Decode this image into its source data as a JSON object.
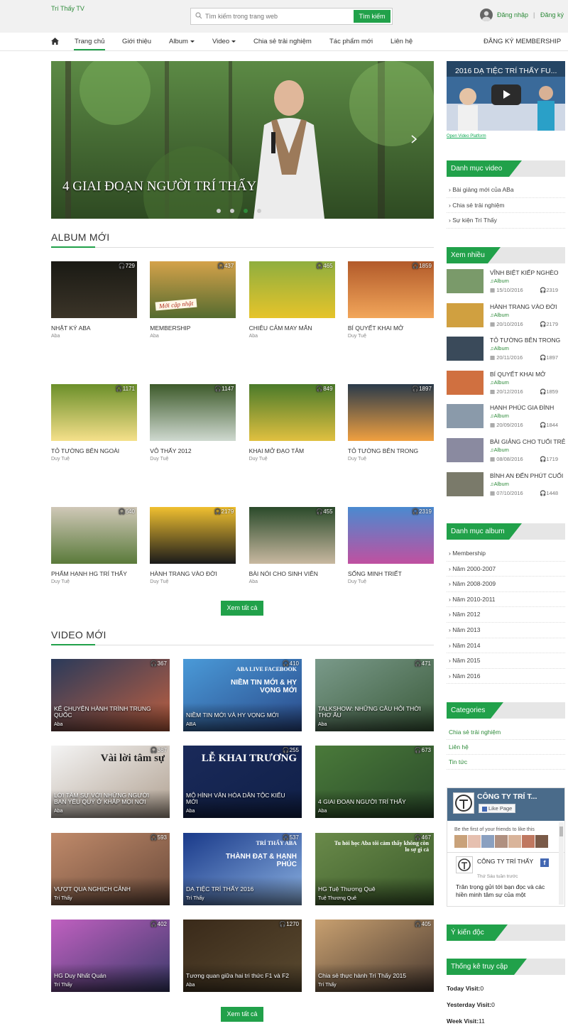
{
  "header": {
    "logo": "Trí Thấy TV",
    "search_placeholder": "Tìm kiếm trong trang web",
    "search_button": "Tìm kiếm",
    "login": "Đăng nhập",
    "separator": "|",
    "register": "Đăng ký"
  },
  "nav": {
    "items": [
      "Trang chủ",
      "Giới thiệu",
      "Album",
      "Video",
      "Chia sẻ trải nghiệm",
      "Tác phẩm mới",
      "Liên hệ"
    ],
    "membership": "ĐĂNG KÝ MEMBERSHIP"
  },
  "slider": {
    "caption": "4 GIAI ĐOẠN NGƯỜI TRÍ THẤY",
    "slide_count": 4,
    "active_slide": 3
  },
  "album_section": {
    "title": "ALBUM MỚI",
    "view_all": "Xem tất cả",
    "items": [
      {
        "title": "NHẬT KÝ ABA",
        "author": "Aba",
        "views": "729"
      },
      {
        "title": "MEMBERSHIP",
        "author": "Aba",
        "views": "437",
        "overlay": "Mới cập nhật"
      },
      {
        "title": "CHIÊU CẢM MAY MẮN",
        "author": "Aba",
        "views": "465"
      },
      {
        "title": "BÍ QUYẾT KHAI MỞ",
        "author": "Duy Tuệ",
        "views": "1859"
      },
      {
        "title": "TỎ TƯỜNG BÊN NGOÀI",
        "author": "Duy Tuệ",
        "views": "1171"
      },
      {
        "title": "VÔ THẤY 2012",
        "author": "Duy Tuệ",
        "views": "1147"
      },
      {
        "title": "KHAI MỞ ĐẠO TÂM",
        "author": "Duy Tuệ",
        "views": "849"
      },
      {
        "title": "TỎ TƯỜNG BÊN TRONG",
        "author": "Duy Tuệ",
        "views": "1897"
      },
      {
        "title": "PHẨM HẠNH HG TRÍ THẤY",
        "author": "Duy Tuệ",
        "views": "640"
      },
      {
        "title": "HÀNH TRANG VÀO ĐỜI",
        "author": "Duy Tuệ",
        "views": "2179"
      },
      {
        "title": "BÀI NÓI CHO SINH VIÊN",
        "author": "Aba",
        "views": "455"
      },
      {
        "title": "SỐNG MINH TRIẾT",
        "author": "Duy Tuệ",
        "views": "2319"
      }
    ]
  },
  "video_section": {
    "title": "VIDEO MỚI",
    "view_all": "Xem tất cả",
    "items": [
      {
        "title": "KỂ CHUYỆN HÀNH TRÌNH TRUNG QUỐC",
        "author": "Aba",
        "views": "367"
      },
      {
        "title": "NIỀM TIN MỚI VÀ HY VỌNG MỚI",
        "author": "ABA",
        "views": "410",
        "overlay_1": "ABA LIVE FACEBOOK",
        "overlay_2": "NIỀM TIN MỚI & HY VỌNG MỚI"
      },
      {
        "title": "TALKSHOW: NHỮNG CÂU HỎI THỜI THƠ ẤU",
        "author": "Aba",
        "views": "471"
      },
      {
        "title": "LỜI TÂM SỰ VỚI NHỮNG NGƯỜI BẠN YÊU QUÝ Ở KHẮP MỌI NƠI",
        "author": "Aba",
        "views": "367",
        "overlay_1": "Vài lời tâm sự"
      },
      {
        "title": "MÔ HÌNH VĂN HÓA DÂN TỘC KIỂU MỚI",
        "author": "Aba",
        "views": "255",
        "overlay_1": "LỄ KHAI TRƯƠNG"
      },
      {
        "title": "4 GIAI ĐOẠN NGƯỜI TRÍ THẤY",
        "author": "Aba",
        "views": "673"
      },
      {
        "title": "VƯỢT QUA NGHỊCH CẢNH",
        "author": "Trí Thấy",
        "views": "593"
      },
      {
        "title": "DẠ TIỆC TRÍ THẤY 2016",
        "author": "Trí Thấy",
        "views": "537",
        "overlay_1": "TRÍ THẤY ABA",
        "overlay_2": "THÀNH ĐẠT & HẠNH PHÚC"
      },
      {
        "title": "HG Tuệ Thương Quê",
        "author": "Tuệ Thương Quê",
        "views": "467",
        "overlay_1": "Tu hỏi học Aba tôi cảm thấy không còn lo sợ gì cả"
      },
      {
        "title": "HG Duy Nhất Quán",
        "author": "Trí Thấy",
        "views": "402"
      },
      {
        "title": "Tương quan giữa hai tri thức F1 và F2",
        "author": "Aba",
        "views": "1270"
      },
      {
        "title": "Chia sẻ thực hành Trí Thấy 2015",
        "author": "Trí Thấy",
        "views": "405"
      }
    ]
  },
  "sidebar": {
    "video_title": "2016 DẠ TIỆC TRÍ THẤY FU...",
    "video_platform": "Open Video Platform",
    "video_categories": {
      "title": "Danh mục video",
      "items": [
        "Bài giảng mới của ABa",
        "Chia sẻ trải nghiệm",
        "Sự kiện Trí Thấy"
      ]
    },
    "most_viewed": {
      "title": "Xem nhiều",
      "items": [
        {
          "title": "VĨNH BIỆT KIẾP NGHÈO",
          "category": "Album",
          "date": "15/10/2016",
          "views": "2319"
        },
        {
          "title": "HÀNH TRANG VÀO ĐỜI",
          "category": "Album",
          "date": "20/10/2016",
          "views": "2179"
        },
        {
          "title": "TỎ TƯỜNG BÊN TRONG",
          "category": "Album",
          "date": "20/11/2016",
          "views": "1897"
        },
        {
          "title": "BÍ QUYẾT KHAI MỞ",
          "category": "Album",
          "date": "20/12/2016",
          "views": "1859"
        },
        {
          "title": "HẠNH PHÚC GIA ĐÌNH",
          "category": "Album",
          "date": "20/09/2016",
          "views": "1844"
        },
        {
          "title": "BÀI GIẢNG CHO TUỔI TRẺ",
          "category": "Album",
          "date": "08/08/2016",
          "views": "1719"
        },
        {
          "title": "BÌNH AN ĐẾN PHÚT CUỐI",
          "category": "Album",
          "date": "07/10/2016",
          "views": "1448"
        }
      ]
    },
    "album_categories": {
      "title": "Danh mục album",
      "items": [
        "Membership",
        "Năm 2000-2007",
        "Năm 2008-2009",
        "Năm 2010-2011",
        "Năm 2012",
        "Năm 2013",
        "Năm 2014",
        "Năm 2015",
        "Năm 2016"
      ]
    },
    "categories": {
      "title": "Categories",
      "items": [
        "Chia sẻ trải nghiệm",
        "Liên hệ",
        "Tin tức"
      ]
    },
    "facebook": {
      "page_name": "CÔNG TY TRÍ T...",
      "like": "Like Page",
      "friends_text": "Be the first of your friends to like this",
      "post_name": "CÔNG TY TRÍ THẤY",
      "post_time": "Thứ Sáu tuần trước",
      "post_text": "Trân trọng gửi tới bạn đọc và các hiền minh tâm sự của một"
    },
    "opinions": {
      "title": "Ý kiến độc giả"
    },
    "stats": {
      "title": "Thống kê truy cập",
      "today_label": "Today Visit:",
      "today": "0",
      "yesterday_label": "Yesterday Visit:",
      "yesterday": "0",
      "week_label": "Week Visit:",
      "week": "11"
    }
  }
}
